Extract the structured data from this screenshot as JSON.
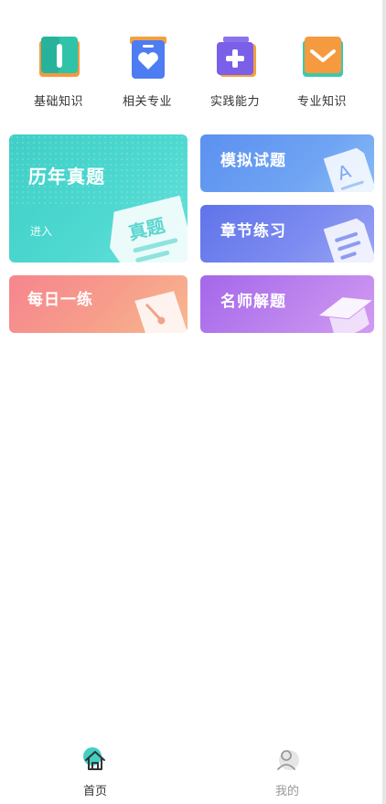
{
  "categories": [
    {
      "label": "基础知识",
      "icon": "book-icon"
    },
    {
      "label": "相关专业",
      "icon": "heart-book-icon"
    },
    {
      "label": "实践能力",
      "icon": "medical-box-icon"
    },
    {
      "label": "专业知识",
      "icon": "mail-book-icon"
    }
  ],
  "cards": {
    "lnzt": {
      "title": "历年真题",
      "enter": "进入",
      "deco_text": "真题",
      "icon": "tag-icon"
    },
    "mnst": {
      "title": "模拟试题",
      "icon": "document-a-icon"
    },
    "zjlx": {
      "title": "章节练习",
      "icon": "document-lines-icon"
    },
    "mryl": {
      "title": "每日一练",
      "icon": "pen-note-icon"
    },
    "msjt": {
      "title": "名师解题",
      "icon": "graduation-cap-icon"
    }
  },
  "nav": {
    "home": {
      "label": "首页",
      "icon": "home-icon",
      "active": true
    },
    "mine": {
      "label": "我的",
      "icon": "user-icon",
      "active": false
    }
  },
  "colors": {
    "teal": "#3fcfc6",
    "blue": "#5b91f0",
    "indigo": "#5f74ea",
    "coral": "#f6858f",
    "purple": "#a467ea",
    "nav_active": "#333333",
    "nav_inactive": "#999999"
  }
}
